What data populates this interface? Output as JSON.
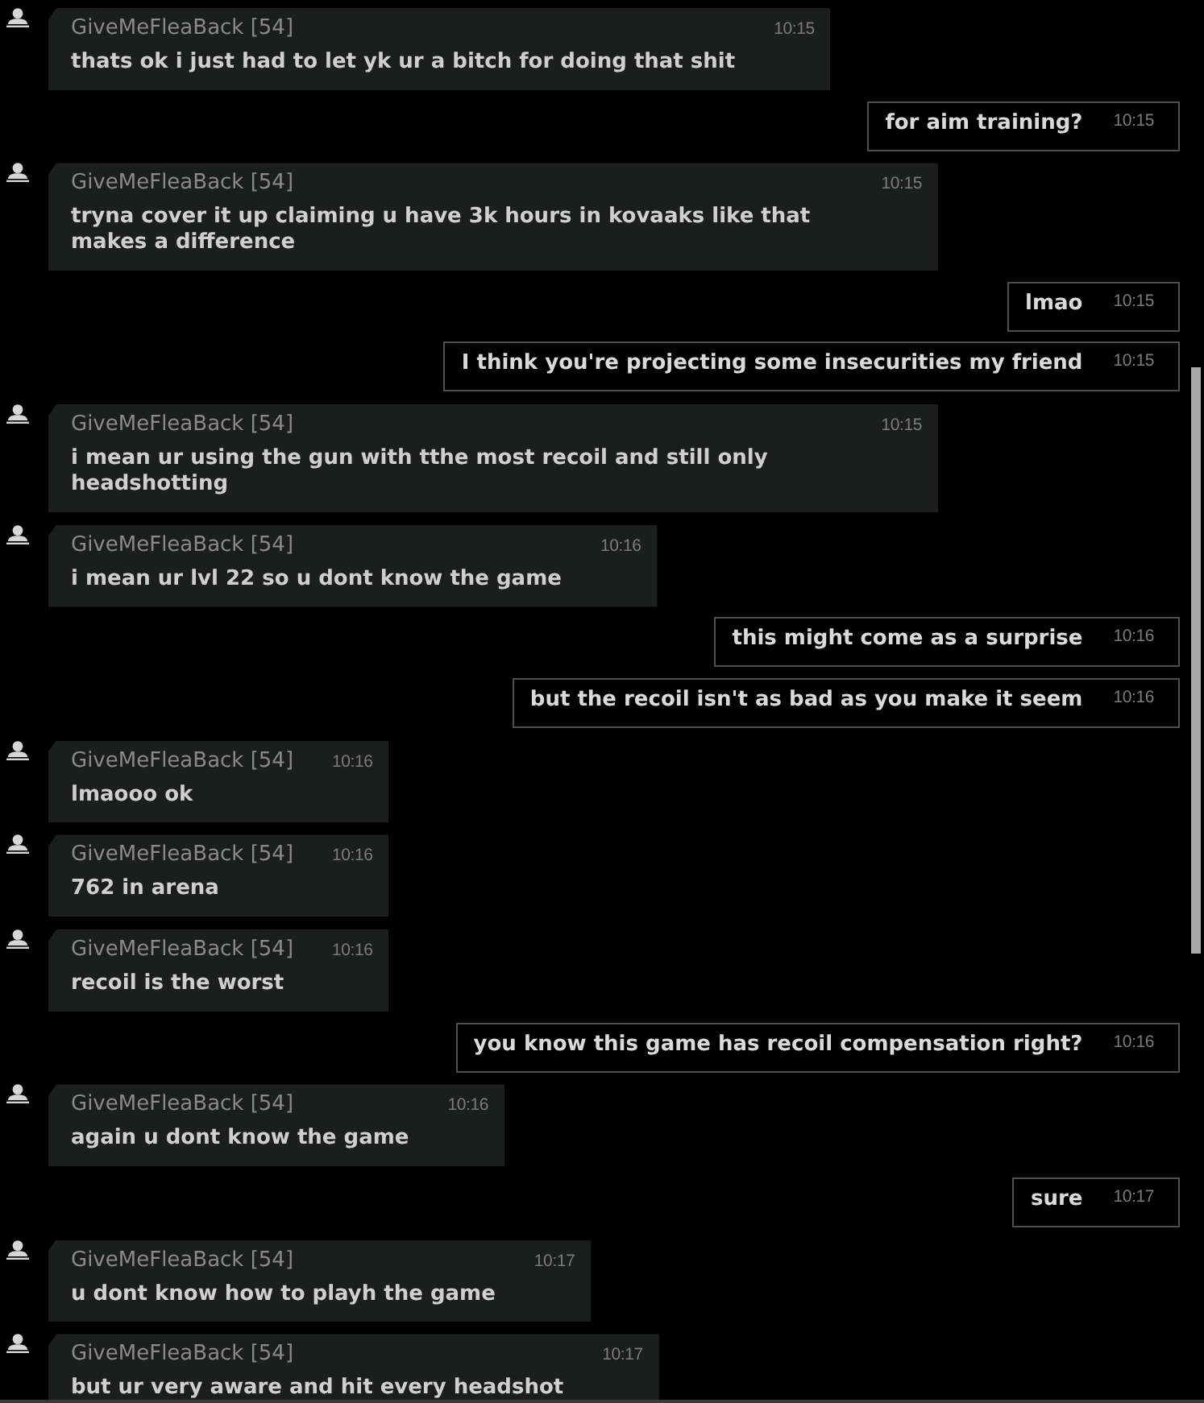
{
  "messages": [
    {
      "kind": "received",
      "author": "GiveMeFleaBack [54]",
      "text": "thats ok i just had to let yk ur a bitch for doing that shit",
      "time": "10:15"
    },
    {
      "kind": "sent",
      "text": "for aim training?",
      "time": "10:15"
    },
    {
      "kind": "received",
      "author": "GiveMeFleaBack [54]",
      "text": "tryna cover it up claiming u have 3k hours in kovaaks like that makes a difference",
      "time": "10:15"
    },
    {
      "kind": "sent",
      "text": "lmao",
      "time": "10:15"
    },
    {
      "kind": "sent",
      "text": "I think you're projecting some insecurities my friend",
      "time": "10:15"
    },
    {
      "kind": "received",
      "author": "GiveMeFleaBack [54]",
      "text": "i mean ur using the gun with tthe most recoil and still only headshotting",
      "time": "10:15"
    },
    {
      "kind": "received",
      "author": "GiveMeFleaBack [54]",
      "text": "i mean ur lvl 22 so u dont know the game",
      "time": "10:16"
    },
    {
      "kind": "sent",
      "text": "this might come as a surprise",
      "time": "10:16"
    },
    {
      "kind": "sent",
      "text": "but the recoil isn't as bad as you make it seem",
      "time": "10:16"
    },
    {
      "kind": "received",
      "author": "GiveMeFleaBack [54]",
      "text": "lmaooo ok",
      "time": "10:16"
    },
    {
      "kind": "received",
      "author": "GiveMeFleaBack [54]",
      "text": "762 in arena",
      "time": "10:16"
    },
    {
      "kind": "received",
      "author": "GiveMeFleaBack [54]",
      "text": "recoil is the worst",
      "time": "10:16"
    },
    {
      "kind": "sent",
      "text": "you know this game has recoil compensation right?",
      "time": "10:16"
    },
    {
      "kind": "received",
      "author": "GiveMeFleaBack [54]",
      "text": "again u dont know the game",
      "time": "10:16"
    },
    {
      "kind": "sent",
      "text": "sure",
      "time": "10:17"
    },
    {
      "kind": "received",
      "author": "GiveMeFleaBack [54]",
      "text": "u dont know how to playh the game",
      "time": "10:17"
    },
    {
      "kind": "received",
      "author": "GiveMeFleaBack [54]",
      "text": "but ur very aware and hit every headshot",
      "time": "10:17"
    }
  ]
}
